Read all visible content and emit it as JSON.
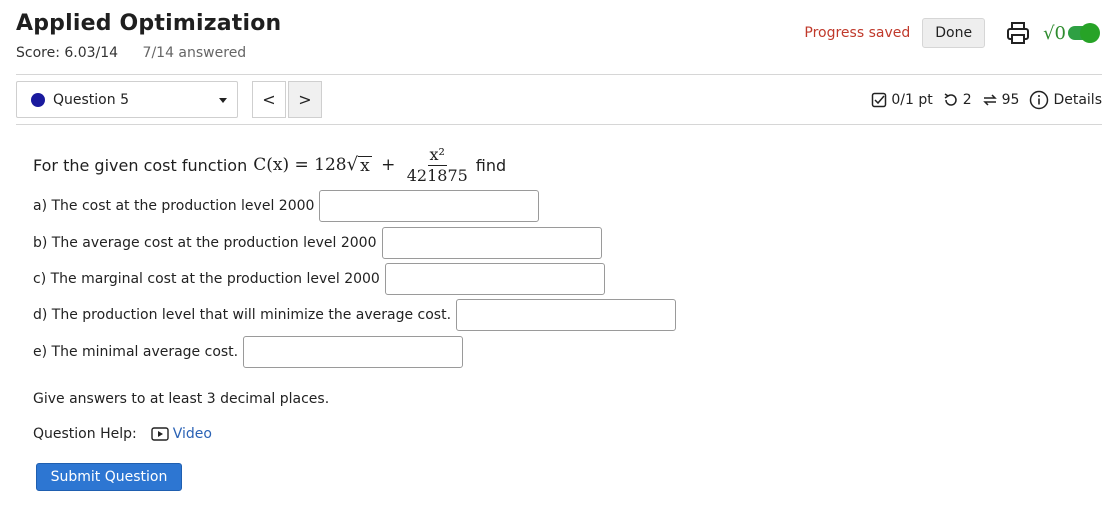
{
  "header": {
    "title": "Applied Optimization",
    "score": "Score: 6.03/14",
    "answered": "7/14 answered",
    "progress_saved": "Progress saved",
    "done_label": "Done",
    "sqrt_glyph": "√0"
  },
  "question_nav": {
    "selected": "Question 5",
    "prev": "<",
    "next": ">"
  },
  "meta": {
    "points": "0/1 pt",
    "retries": "2",
    "attempts": "95",
    "details": "Details"
  },
  "question": {
    "intro": "For the given cost function",
    "formula_lhs": "C(x) = 128",
    "sqrt_arg": "x",
    "plus": "+",
    "frac_num": "x²",
    "frac_den": "421875",
    "find": "find",
    "parts": [
      {
        "label": "a) The cost at the production level 2000",
        "value": ""
      },
      {
        "label": "b) The average cost at the production level 2000",
        "value": ""
      },
      {
        "label": "c) The marginal cost at the production level 2000",
        "value": ""
      },
      {
        "label": "d) The production level that will minimize the average cost.",
        "value": ""
      },
      {
        "label": "e) The minimal average cost.",
        "value": ""
      }
    ],
    "note": "Give answers to at least 3 decimal places.",
    "help_label": "Question Help:",
    "video_label": "Video",
    "submit_label": "Submit Question"
  },
  "colors": {
    "progress_saved": "#c0392b",
    "accent_blue": "#2d76d2",
    "toggle_green": "#27a327",
    "question_dot": "#1a1a9e"
  }
}
